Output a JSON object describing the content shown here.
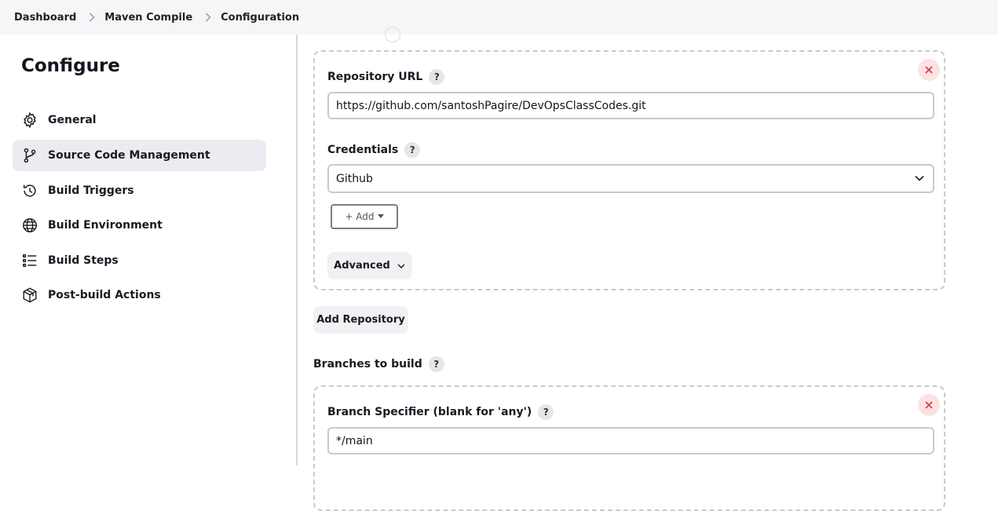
{
  "breadcrumb": {
    "items": [
      {
        "label": "Dashboard"
      },
      {
        "label": "Maven Compile"
      },
      {
        "label": "Configuration"
      }
    ]
  },
  "sidebar": {
    "title": "Configure",
    "items": [
      {
        "label": "General",
        "icon": "gear-icon"
      },
      {
        "label": "Source Code Management",
        "icon": "git-branch-icon",
        "active": true
      },
      {
        "label": "Build Triggers",
        "icon": "clock-icon"
      },
      {
        "label": "Build Environment",
        "icon": "globe-icon"
      },
      {
        "label": "Build Steps",
        "icon": "list-icon"
      },
      {
        "label": "Post-build Actions",
        "icon": "package-icon"
      }
    ]
  },
  "repository": {
    "url_label": "Repository URL",
    "url_value": "https://github.com/santoshPagire/DevOpsClassCodes.git",
    "credentials_label": "Credentials",
    "credentials_value": "Github",
    "add_label": "+ Add",
    "advanced_label": "Advanced"
  },
  "add_repository_label": "Add Repository",
  "branches": {
    "section_label": "Branches to build",
    "specifier_label": "Branch Specifier (blank for 'any')",
    "specifier_value": "*/main"
  },
  "help_glyph": "?",
  "colors": {
    "close_bg": "#fbe3e3",
    "close_x": "#e0343c",
    "active_nav_bg": "#ebebf2"
  }
}
